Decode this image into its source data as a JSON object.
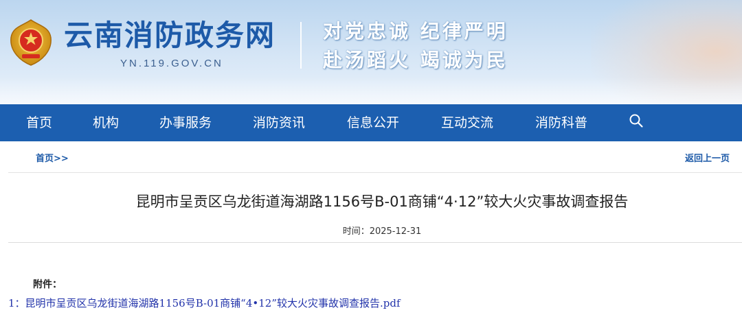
{
  "header": {
    "site_title": "云南消防政务网",
    "site_domain": "YN.119.GOV.CN",
    "slogan_line1": "对党忠诚 纪律严明",
    "slogan_line2": "赴汤蹈火 竭诚为民"
  },
  "nav": {
    "items": [
      {
        "label": "首页"
      },
      {
        "label": "机构"
      },
      {
        "label": "办事服务"
      },
      {
        "label": "消防资讯"
      },
      {
        "label": "信息公开"
      },
      {
        "label": "互动交流"
      },
      {
        "label": "消防科普"
      }
    ],
    "search_icon": "search-icon"
  },
  "breadcrumb": {
    "home": "首页>>",
    "back": "返回上一页"
  },
  "article": {
    "title": "昆明市呈贡区乌龙街道海湖路1156号B-01商铺“4·12”较大火灾事故调查报告",
    "time_label": "时间：",
    "time_value": "2025-12-31",
    "attachment_label": "附件：",
    "attachments": [
      {
        "index": "1：",
        "name": "昆明市呈贡区乌龙街道海湖路1156号B-01商铺“4•12”较大火灾事故调查报告.pdf"
      }
    ]
  },
  "colors": {
    "nav_bg": "#1c5fb0",
    "brand_blue": "#1d5aa8",
    "link_blue": "#2233aa"
  }
}
